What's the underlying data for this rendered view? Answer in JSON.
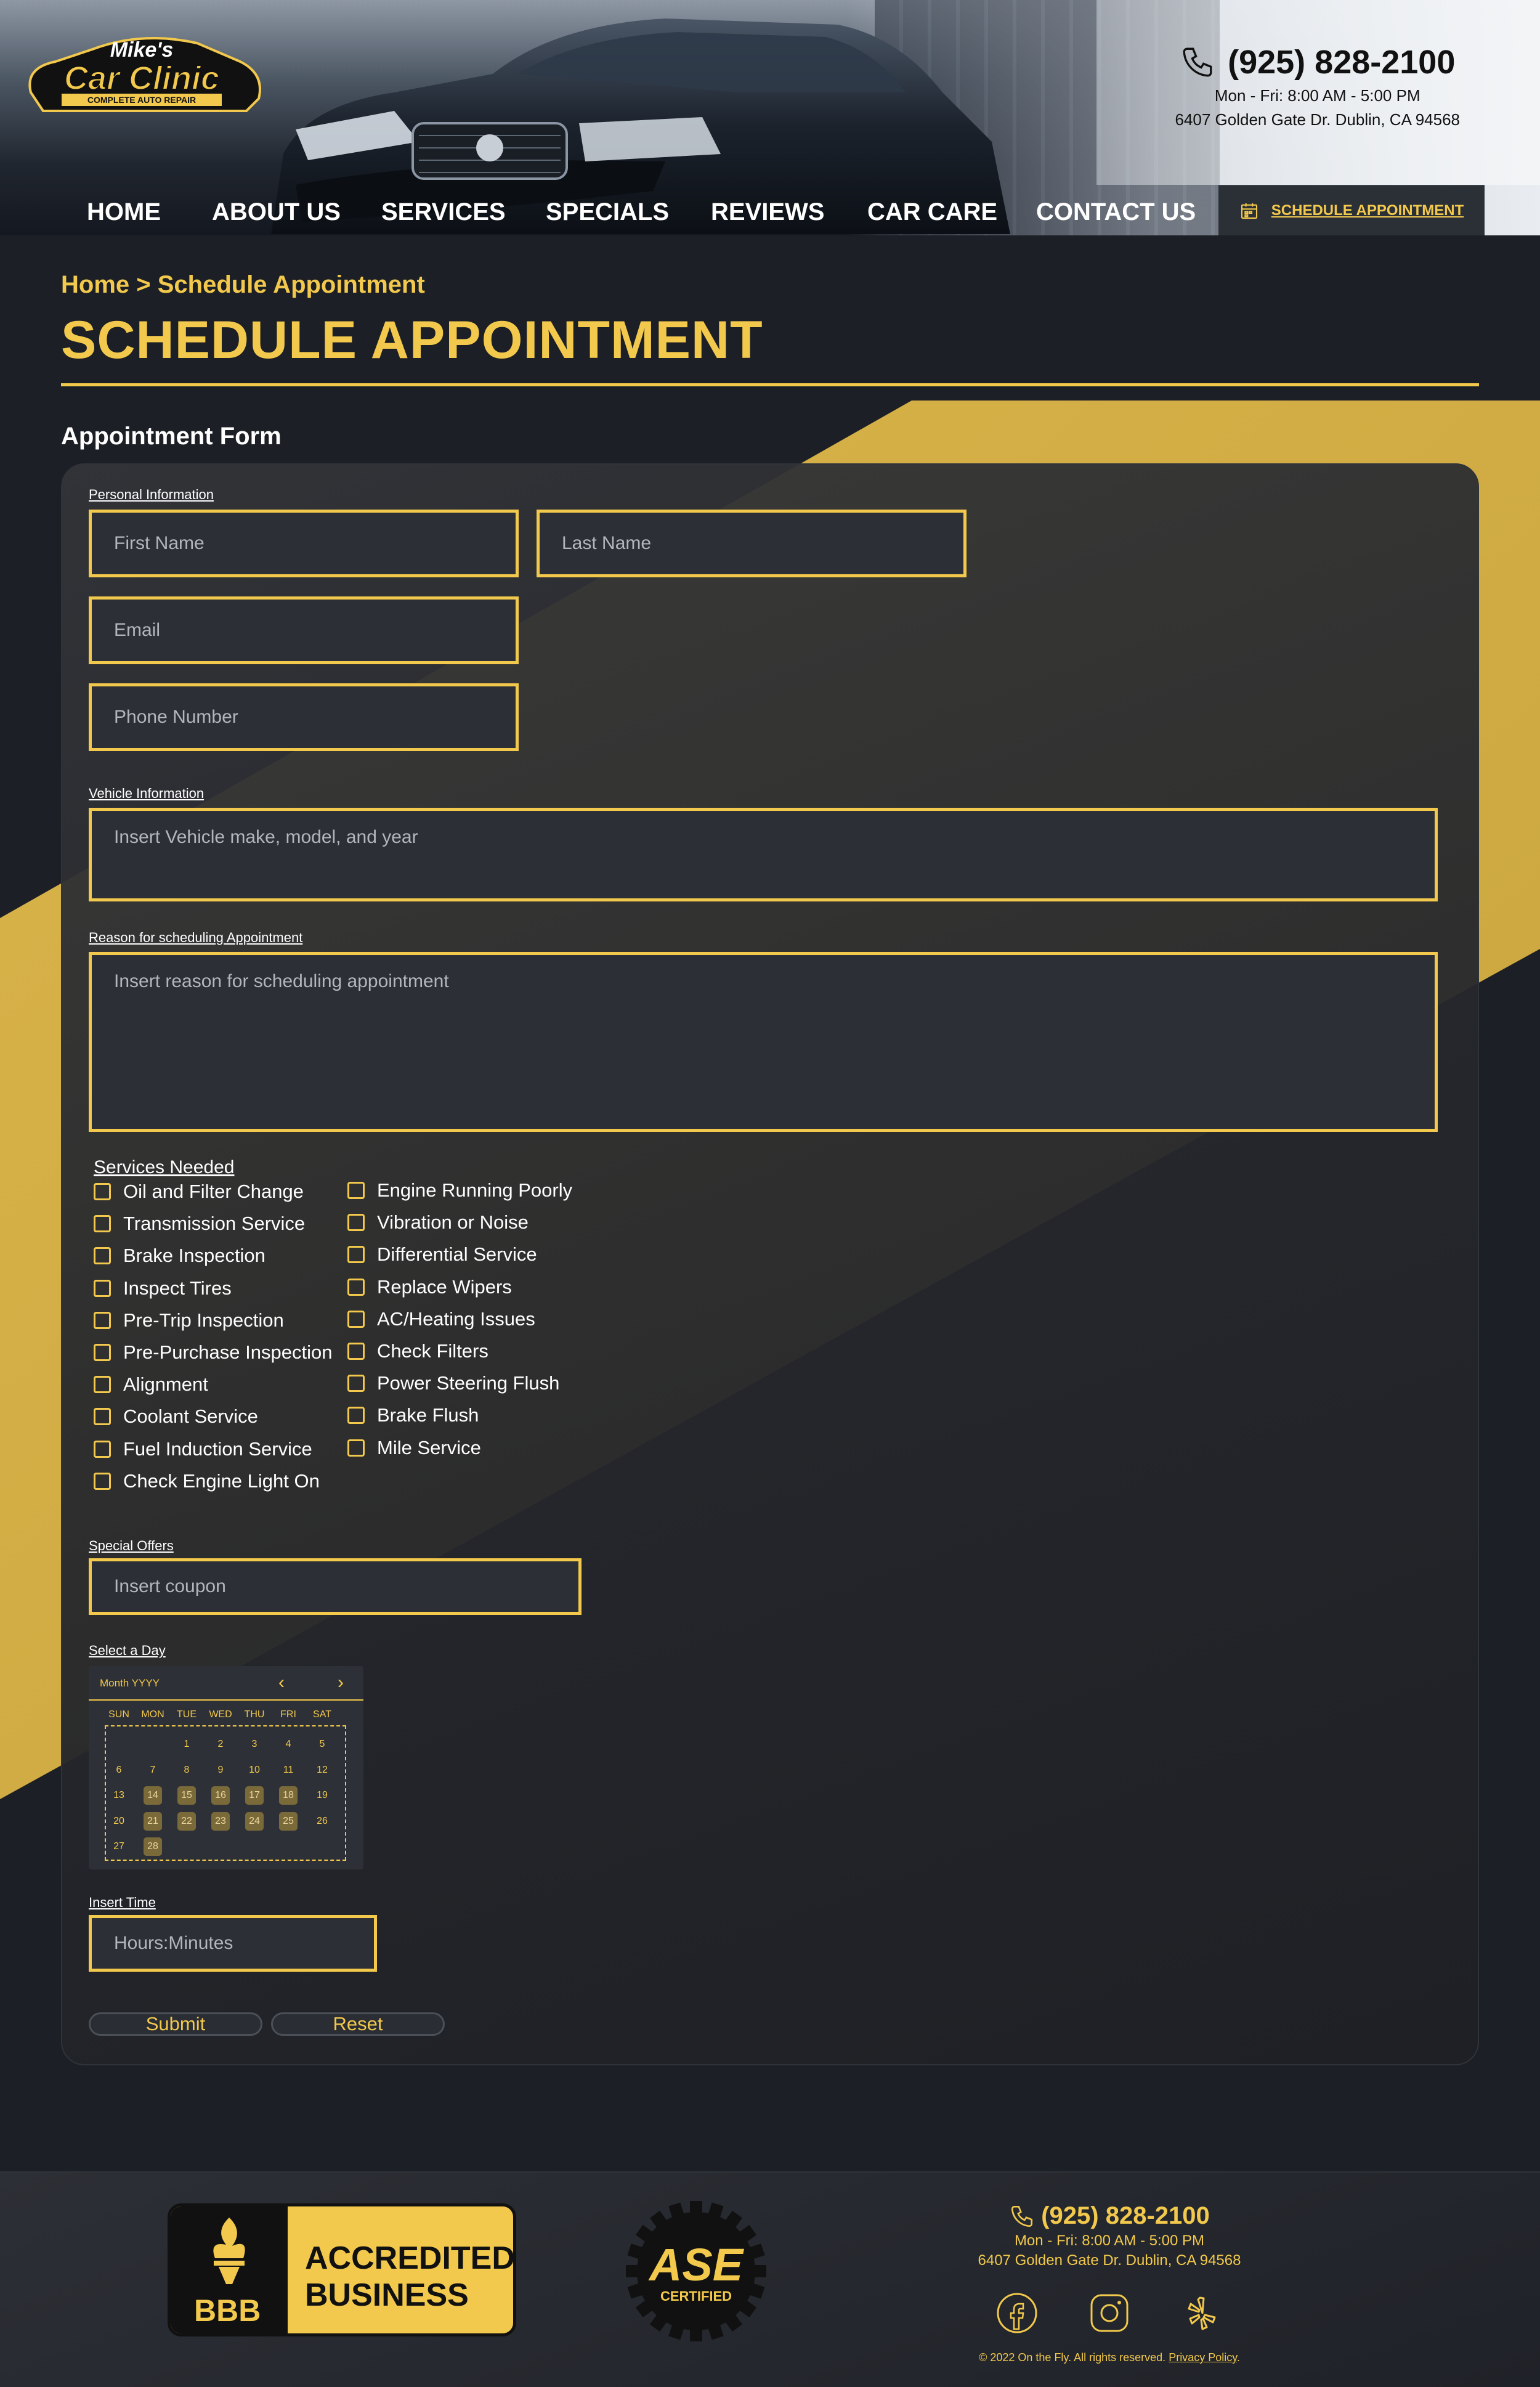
{
  "brand": {
    "logo_line1": "Mike's",
    "logo_line2": "Car Clinic",
    "logo_tagline": "COMPLETE AUTO REPAIR"
  },
  "header": {
    "phone": "(925) 828-2100",
    "hours": "Mon - Fri: 8:00 AM - 5:00 PM",
    "address": "6407 Golden Gate Dr. Dublin, CA 94568"
  },
  "nav": {
    "items": [
      "HOME",
      "ABOUT US",
      "SERVICES",
      "SPECIALS",
      "REVIEWS",
      "CAR CARE",
      "CONTACT US"
    ],
    "cta": "SCHEDULE APPOINTMENT"
  },
  "page": {
    "breadcrumb": "Home > Schedule Appointment",
    "title": "SCHEDULE APPOINTMENT",
    "form_heading": "Appointment Form"
  },
  "form": {
    "personal_label": "Personal Information",
    "first_name_placeholder": "First Name",
    "last_name_placeholder": "Last Name",
    "email_placeholder": "Email",
    "phone_placeholder": "Phone Number",
    "vehicle_label": "Vehicle Information",
    "vehicle_placeholder": "Insert Vehicle make, model, and year",
    "reason_label": "Reason for scheduling Appointment",
    "reason_placeholder": "Insert reason for scheduling appointment",
    "services_title": "Services Needed",
    "services_col1": [
      "Oil and Filter Change",
      "Transmission Service",
      "Brake Inspection",
      "Inspect Tires",
      "Pre-Trip Inspection",
      "Pre-Purchase Inspection",
      "Alignment",
      "Coolant Service",
      "Fuel Induction Service",
      "Check Engine Light On"
    ],
    "services_col2": [
      "Engine Running Poorly",
      "Vibration or Noise",
      "Differential Service",
      "Replace Wipers",
      "AC/Heating Issues",
      "Check Filters",
      "Power Steering Flush",
      "Brake Flush",
      "Mile Service"
    ],
    "offers_label": "Special Offers",
    "coupon_placeholder": "Insert coupon",
    "day_label": "Select a Day",
    "calendar": {
      "month": "Month YYYY",
      "dow": [
        "SUN",
        "MON",
        "TUE",
        "WED",
        "THU",
        "FRI",
        "SAT"
      ],
      "weeks": [
        [
          "",
          "",
          "1",
          "2",
          "3",
          "4",
          "5"
        ],
        [
          "6",
          "7",
          "8",
          "9",
          "10",
          "11",
          "12"
        ],
        [
          "13",
          "14",
          "15",
          "16",
          "17",
          "18",
          "19"
        ],
        [
          "20",
          "21",
          "22",
          "23",
          "24",
          "25",
          "26"
        ],
        [
          "27",
          "28",
          "",
          "",
          "",
          "",
          ""
        ]
      ],
      "highlighted": [
        "14",
        "15",
        "16",
        "17",
        "18",
        "21",
        "22",
        "23",
        "24",
        "25",
        "28"
      ]
    },
    "time_label": "Insert Time",
    "time_placeholder": "Hours:Minutes",
    "submit_label": "Submit",
    "reset_label": "Reset"
  },
  "footer": {
    "bbb_line1": "ACCREDITED",
    "bbb_line2": "BUSINESS",
    "bbb_mark": "BBB",
    "ase_text": "ASE",
    "ase_sub": "CERTIFIED",
    "phone": "(925) 828-2100",
    "hours": "Mon - Fri: 8:00 AM - 5:00 PM",
    "address": "6407 Golden Gate Dr. Dublin, CA 94568",
    "copyright": "© 2022 On the Fly. All rights reserved.",
    "privacy": "Privacy Policy",
    "socials": [
      "facebook-icon",
      "instagram-icon",
      "yelp-icon"
    ]
  },
  "colors": {
    "accent": "#f2c94c",
    "background": "#1c1f25",
    "field": "#2c2f35"
  }
}
